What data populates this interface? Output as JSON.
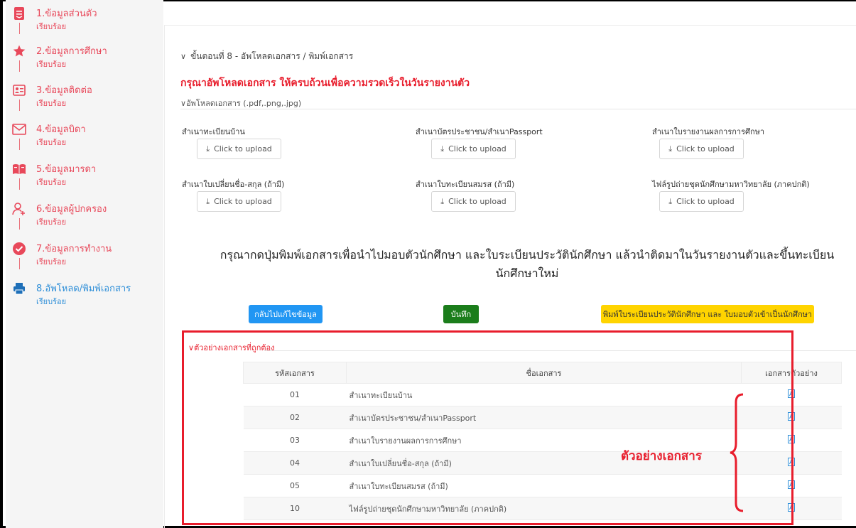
{
  "sidebar": {
    "steps": [
      {
        "title": "1.ข้อมูลส่วนตัว",
        "status": "เรียบร้อย",
        "icon": "document-icon"
      },
      {
        "title": "2.ข้อมูลการศึกษา",
        "status": "เรียบร้อย",
        "icon": "star-icon"
      },
      {
        "title": "3.ข้อมูลติดต่อ",
        "status": "เรียบร้อย",
        "icon": "contact-card-icon"
      },
      {
        "title": "4.ข้อมูลบิดา",
        "status": "เรียบร้อย",
        "icon": "envelope-icon"
      },
      {
        "title": "5.ข้อมูลมารดา",
        "status": "เรียบร้อย",
        "icon": "book-icon"
      },
      {
        "title": "6.ข้อมูลผู้ปกครอง",
        "status": "เรียบร้อย",
        "icon": "user-add-icon"
      },
      {
        "title": "7.ข้อมูลการทำงาน",
        "status": "เรียบร้อย",
        "icon": "check-circle-icon"
      },
      {
        "title": "8.อัพโหลด/พิมพ์เอกสาร",
        "status": "เรียบร้อย",
        "icon": "printer-icon"
      }
    ]
  },
  "main": {
    "step_header": "ขั้นตอนที่ 8 - อัพโหลดเอกสาร / พิมพ์เอกสาร",
    "warning": "กรุณาอัพโหลดเอกสาร ให้ครบถ้วนเพื่อความรวดเร็วในวันรายงานตัว",
    "upload_section_title": "อัพโหลดเอกสาร (.pdf,.png,.jpg)",
    "upload_button_label": "Click to upload",
    "upload_items": [
      "สำเนาทะเบียนบ้าน",
      "สำเนาบัตรประชาชน/สำเนาPassport",
      "สำเนาใบรายงานผลการการศึกษา",
      "สำเนาใบเปลี่ยนชื่อ-สกุล (ถ้ามี)",
      "สำเนาใบทะเบียนสมรส (ถ้ามี)",
      "ไฟล์รูปถ่ายชุดนักศึกษามหาวิทยาลัย (ภาคปกติ)"
    ],
    "instruction_line1": "กรุณากดปุ่มพิมพ์เอกสารเพื่อนำไปมอบตัวนักศึกษา และใบระเบียนประวัตินักศึกษา แล้วนำติดมาในวันรายงานตัวและขึ้นทะเบียน",
    "instruction_line2": "นักศึกษาใหม่",
    "buttons": {
      "back": "กลับไปแก้ไขข้อมูล",
      "save": "บันทึก",
      "print": "พิมพ์ใบระเบียนประวัตินักศึกษา และ ใบมอบตัวเข้าเป็นนักศึกษา"
    },
    "example_section_title": "ตัวอย่างเอกสารที่ถูกต้อง",
    "table": {
      "headers": [
        "รหัสเอกสาร",
        "ชื่อเอกสาร",
        "เอกสารตัวอย่าง"
      ],
      "rows": [
        {
          "code": "01",
          "name": "สำเนาทะเบียนบ้าน"
        },
        {
          "code": "02",
          "name": "สำเนาบัตรประชาชน/สำเนาPassport"
        },
        {
          "code": "03",
          "name": "สำเนาใบรายงานผลการการศึกษา"
        },
        {
          "code": "04",
          "name": "สำเนาใบเปลี่ยนชื่อ-สกุล (ถ้ามี)"
        },
        {
          "code": "05",
          "name": "สำเนาใบทะเบียนสมรส (ถ้ามี)"
        },
        {
          "code": "10",
          "name": "ไฟล์รูปถ่ายชุดนักศึกษามหาวิทยาลัย (ภาคปกติ)"
        }
      ]
    },
    "annotation": "ตัวอย่างเอกสาร"
  },
  "colors": {
    "step_pink": "#e8485a",
    "current_blue": "#2f8fd8",
    "warning_red": "#e81d2c",
    "btn_blue": "#2196f3",
    "btn_green": "#1b7d1b",
    "btn_yellow": "#ffd400"
  }
}
